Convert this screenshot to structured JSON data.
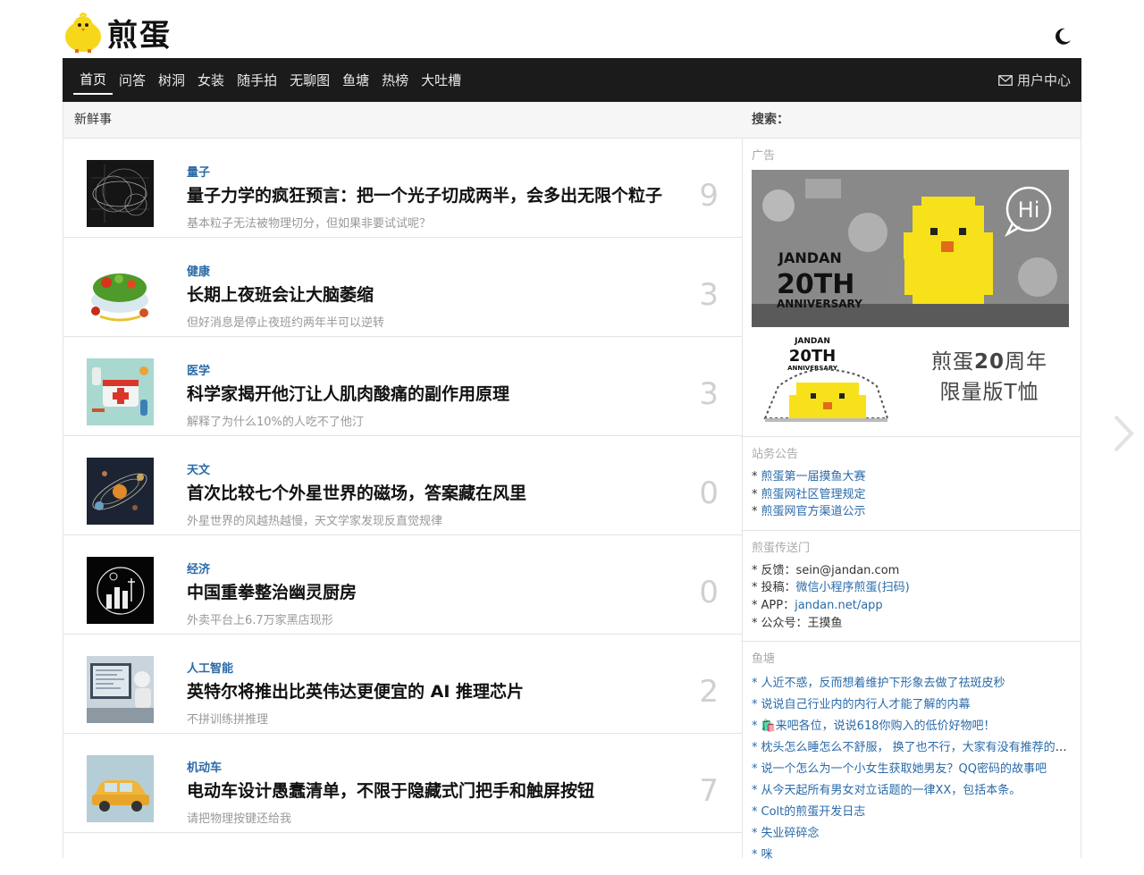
{
  "header": {
    "logo_text": "煎蛋",
    "theme_toggle_icon": "moon-icon"
  },
  "nav": {
    "items": [
      "首页",
      "问答",
      "树洞",
      "女装",
      "随手拍",
      "无聊图",
      "鱼塘",
      "热榜",
      "大吐槽"
    ],
    "active_index": 0,
    "user_center_label": "用户中心"
  },
  "main": {
    "section_title": "新鲜事",
    "posts": [
      {
        "category": "量子",
        "title": "量子力学的疯狂预言：把一个光子切成两半，会多出无限个粒子",
        "subtitle": "基本粒子无法被物理切分，但如果非要试试呢？",
        "count": "9"
      },
      {
        "category": "健康",
        "title": "长期上夜班会让大脑萎缩",
        "subtitle": "但好消息是停止夜班约两年半可以逆转",
        "count": "3"
      },
      {
        "category": "医学",
        "title": "科学家揭开他汀让人肌肉酸痛的副作用原理",
        "subtitle": "解释了为什么10%的人吃不了他汀",
        "count": "3"
      },
      {
        "category": "天文",
        "title": "首次比较七个外星世界的磁场，答案藏在风里",
        "subtitle": "外星世界的风越热越慢，天文学家发现反直觉规律",
        "count": "0"
      },
      {
        "category": "经济",
        "title": "中国重拳整治幽灵厨房",
        "subtitle": "外卖平台上6.7万家黑店现形",
        "count": "0"
      },
      {
        "category": "人工智能",
        "title": "英特尔将推出比英伟达更便宜的 AI 推理芯片",
        "subtitle": "不拼训练拼推理",
        "count": "2"
      },
      {
        "category": "机动车",
        "title": "电动车设计愚蠢清单，不限于隐藏式门把手和触屏按钮",
        "subtitle": "请把物理按键还给我",
        "count": "7"
      }
    ]
  },
  "side": {
    "search_label": "搜索：",
    "ad": {
      "title": "广告",
      "banner_line1": "JANDAN",
      "banner_line2": "20TH",
      "banner_line3": "ANNIVERSARY",
      "bubble_text": "Hi",
      "small_badge_line1": "JANDAN",
      "small_badge_line2": "20TH",
      "small_badge_line3": "ANNIVERSARY",
      "tshirt_line1_a": "煎蛋",
      "tshirt_line1_b": "20",
      "tshirt_line1_c": "周年",
      "tshirt_line2": "限量版T恤"
    },
    "announcements": {
      "title": "站务公告",
      "items": [
        "煎蛋第一届摸鱼大赛",
        "煎蛋网社区管理规定",
        "煎蛋网官方渠道公示"
      ]
    },
    "portal": {
      "title": "煎蛋传送门",
      "items": [
        {
          "label": "反馈：",
          "value": "sein@jandan.com",
          "link": false
        },
        {
          "label": "投稿：",
          "value": "微信小程序煎蛋(扫码)",
          "link": true
        },
        {
          "label": "APP：",
          "value": "jandan.net/app",
          "link": true
        },
        {
          "label": "公众号：",
          "value": "王摸鱼",
          "link": false
        }
      ]
    },
    "fishpond": {
      "title": "鱼塘",
      "items": [
        "人近不惑，反而想着维护下形象去做了祛斑皮秒",
        "说说自己行业内的内行人才能了解的内幕",
        "🛍️来吧各位，说说618你购入的低价好物吧！",
        "枕头怎么睡怎么不舒服， 换了也不行，大家有没有推荐的枕头",
        "说一个怎么为一个小女生获取她男友？QQ密码的故事吧",
        "从今天起所有男女对立话题的一律XX，包括本条。",
        "Colt的煎蛋开发日志",
        "失业碎碎念",
        "咪"
      ]
    }
  },
  "colors": {
    "nav_bg": "#1b1b1b",
    "link": "#2a6aa8",
    "chick_yellow": "#f7e11a"
  }
}
